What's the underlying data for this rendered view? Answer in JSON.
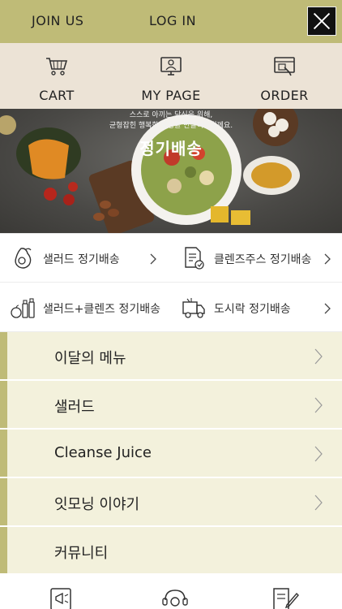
{
  "topbar": {
    "join_label": "JOIN US",
    "login_label": "LOG IN"
  },
  "quick_menu": [
    {
      "label": "CART",
      "icon": "cart-icon"
    },
    {
      "label": "MY PAGE",
      "icon": "mypage-icon"
    },
    {
      "label": "ORDER",
      "icon": "order-icon"
    }
  ],
  "banner": {
    "line1": "스스로 아끼는 당신을 위해,",
    "line2": "균형잡힌 행복한 일상을 만들어드릴께요.",
    "title": "정기배송"
  },
  "subscriptions": [
    {
      "label": "샐러드 정기배송",
      "icon": "avocado-icon"
    },
    {
      "label": "클렌즈주스 정기배송",
      "icon": "document-icon"
    },
    {
      "label": "샐러드+클렌즈 정기배송",
      "icon": "bottles-icon"
    },
    {
      "label": "도시락 정기배송",
      "icon": "truck-icon"
    }
  ],
  "categories": [
    {
      "label": "이달의 메뉴",
      "chevron": true
    },
    {
      "label": "샐러드",
      "chevron": true
    },
    {
      "label": "Cleanse Juice",
      "chevron": true
    },
    {
      "label": "잇모닝 이야기",
      "chevron": true
    },
    {
      "label": "커뮤니티",
      "chevron": false
    }
  ],
  "bottom_bar": [
    {
      "icon": "megaphone-icon"
    },
    {
      "icon": "customer-service-icon"
    },
    {
      "icon": "review-icon"
    }
  ],
  "colors": {
    "accent": "#bfbb77",
    "quick_bg": "#ece3d6",
    "category_bg": "#f3f1dc"
  }
}
